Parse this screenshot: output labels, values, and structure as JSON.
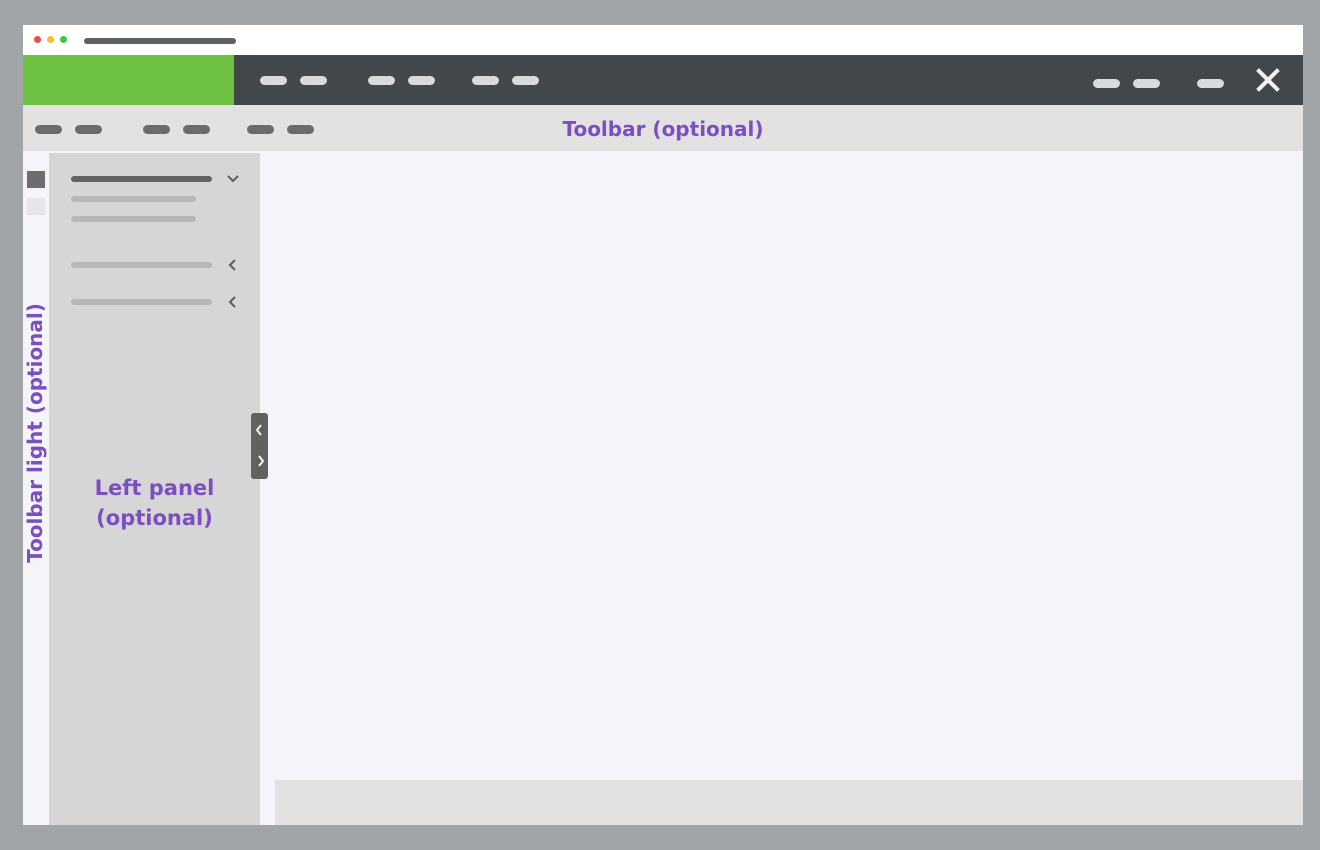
{
  "toolbar": {
    "title": "Toolbar (optional)"
  },
  "vertical_toolbar": {
    "title": "Toolbar light (optional)"
  },
  "left_panel": {
    "title": "Left panel\n(optional)"
  },
  "icons": {
    "close": "close-icon",
    "chevron_down": "chevron-down-icon",
    "chevron_left": "chevron-left-icon",
    "chevron_right": "chevron-right-icon"
  },
  "colors": {
    "brand": "#6fc143",
    "header": "#41474b",
    "toolbar": "#e2e2e2",
    "left_panel": "#d6d6d6",
    "content": "#f3f5f9",
    "label_accent": "#7c4fc0"
  }
}
